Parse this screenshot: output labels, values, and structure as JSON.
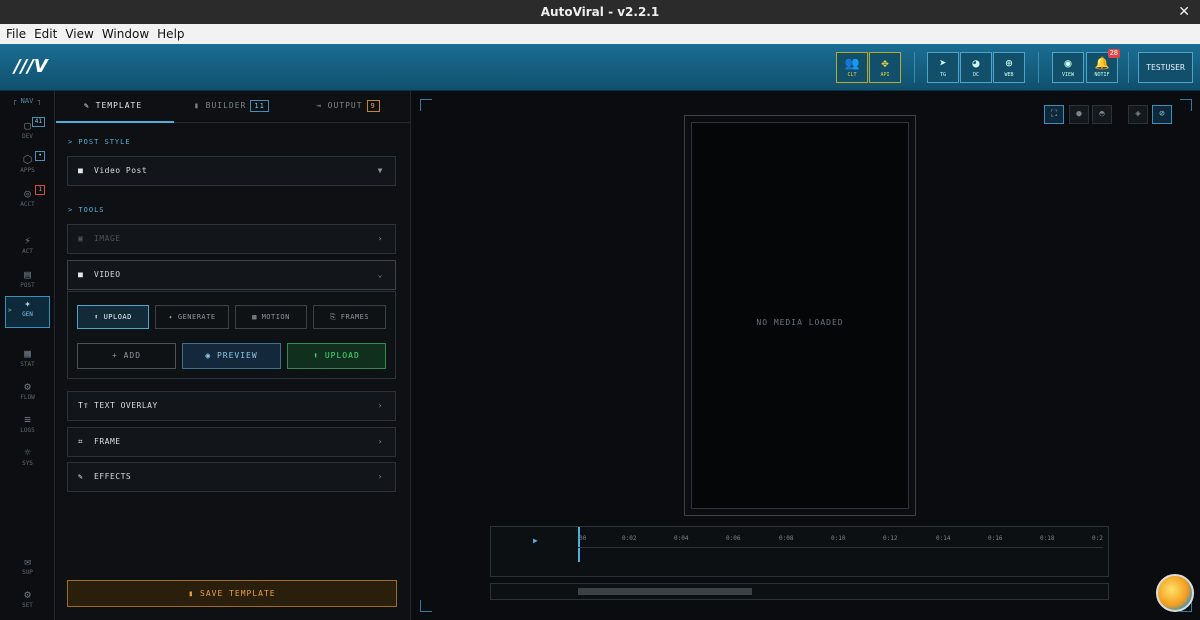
{
  "window": {
    "title": "AutoViral - v2.2.1",
    "close": "✕"
  },
  "menu": [
    "File",
    "Edit",
    "View",
    "Window",
    "Help"
  ],
  "header": {
    "logo": "///V",
    "buttons": [
      {
        "label": "CLT",
        "icon": "users-icon"
      },
      {
        "label": "API",
        "icon": "network-icon"
      },
      {
        "label": "TG",
        "icon": "telegram-icon"
      },
      {
        "label": "DC",
        "icon": "discord-icon"
      },
      {
        "label": "WEB",
        "icon": "globe-icon"
      },
      {
        "label": "VIEW",
        "icon": "eye-icon"
      },
      {
        "label": "NOTIF",
        "icon": "bell-icon",
        "badge": "28"
      }
    ],
    "user": "TESTUSER"
  },
  "nav": {
    "head": "NAV",
    "items": [
      {
        "label": "DEV",
        "count": "41"
      },
      {
        "label": "APPS",
        "count": "•"
      },
      {
        "label": "ACCT",
        "count": "1"
      },
      {
        "label": "ACT"
      },
      {
        "label": "POST"
      },
      {
        "label": "GEN",
        "marker": ">"
      },
      {
        "label": "STAT"
      },
      {
        "label": "FLOW"
      },
      {
        "label": "LOGS"
      },
      {
        "label": "SYS"
      },
      {
        "label": "SUP"
      },
      {
        "label": "SET"
      }
    ]
  },
  "tabs": [
    {
      "label": "TEMPLATE"
    },
    {
      "label": "BUILDER",
      "count": "11"
    },
    {
      "label": "OUTPUT",
      "count": "9"
    }
  ],
  "post_style": {
    "section": "> POST STYLE",
    "value": "Video Post",
    "arrow": "▼"
  },
  "tools": {
    "section": "> TOOLS",
    "image": "IMAGE",
    "video": "VIDEO",
    "video_modes": [
      "UPLOAD",
      "GENERATE",
      "MOTION",
      "FRAMES"
    ],
    "actions": {
      "add": "+ ADD",
      "preview": "PREVIEW",
      "upload": "UPLOAD"
    },
    "text_overlay": "TEXT OVERLAY",
    "frame": "FRAME",
    "effects": "EFFECTS"
  },
  "save_label": "SAVE TEMPLATE",
  "canvas": {
    "empty": "NO MEDIA LOADED"
  },
  "timeline": {
    "ticks": [
      "00",
      "0:02",
      "0:04",
      "0:06",
      "0:08",
      "0:10",
      "0:12",
      "0:14",
      "0:16",
      "0:18",
      "0:2"
    ],
    "play": "▶"
  },
  "colors": {
    "accent": "#4fb0dc",
    "header": "#1a6e93",
    "save": "#e9a13d",
    "upload": "#3ee07a"
  }
}
